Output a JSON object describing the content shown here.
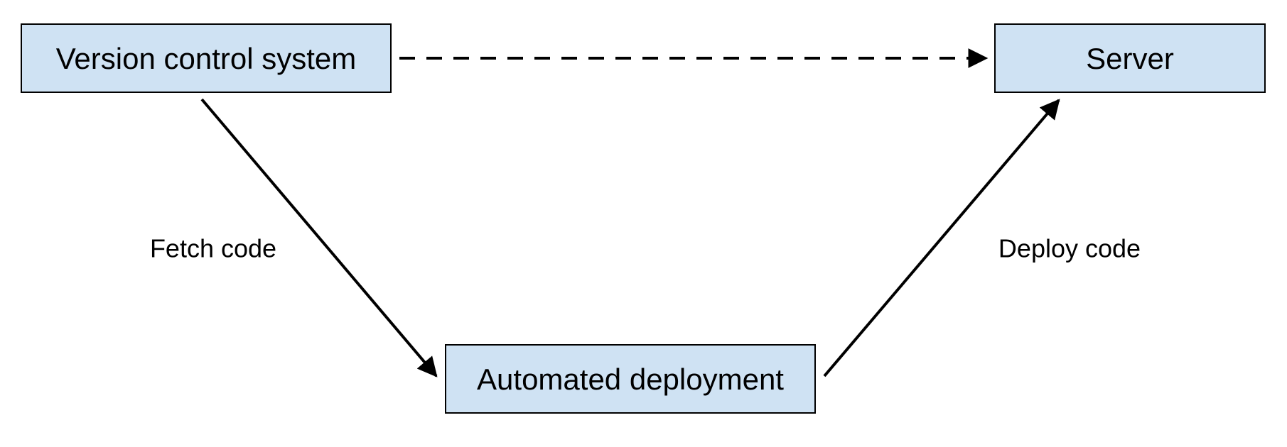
{
  "nodes": {
    "vcs": {
      "label": "Version control system"
    },
    "auto": {
      "label": "Automated deployment"
    },
    "server": {
      "label": "Server"
    }
  },
  "edges": {
    "fetch": {
      "label": "Fetch code"
    },
    "deploy": {
      "label": "Deploy code"
    }
  }
}
